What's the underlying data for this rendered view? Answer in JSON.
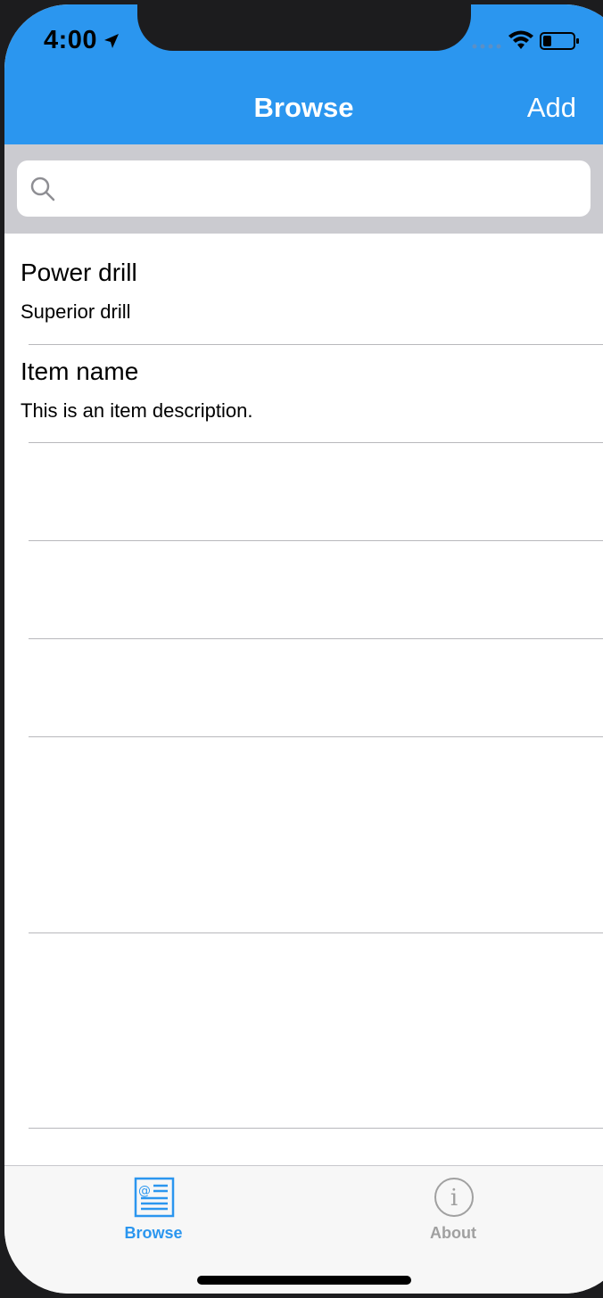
{
  "status_bar": {
    "time": "4:00"
  },
  "nav_bar": {
    "title": "Browse",
    "add_label": "Add",
    "color": "#2b96ef"
  },
  "search": {
    "value": "",
    "placeholder": ""
  },
  "items": [
    {
      "title": "Power drill",
      "description": "Superior drill"
    },
    {
      "title": "Item name",
      "description": "This is an item description."
    },
    {
      "title": "",
      "description": ""
    },
    {
      "title": "",
      "description": ""
    },
    {
      "title": "",
      "description": ""
    },
    {
      "title": "",
      "description": ""
    },
    {
      "title": "",
      "description": ""
    }
  ],
  "tabs": [
    {
      "label": "Browse",
      "icon": "browse-icon",
      "active": true
    },
    {
      "label": "About",
      "icon": "info-icon",
      "active": false
    }
  ]
}
